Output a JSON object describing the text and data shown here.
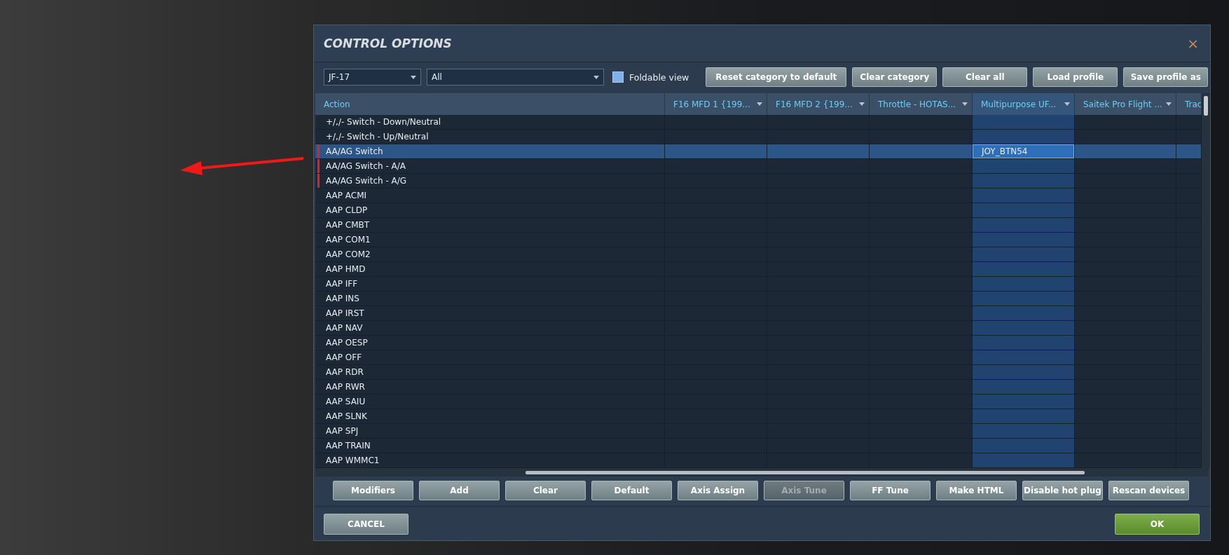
{
  "dialog": {
    "title": "CONTROL OPTIONS",
    "close": "×"
  },
  "toolbar": {
    "aircraft": "JF-17",
    "category": "All",
    "foldable": {
      "label": "Foldable view",
      "checked": false
    },
    "buttons": [
      {
        "label": "Reset category to default"
      },
      {
        "label": "Clear category"
      },
      {
        "label": "Clear all"
      },
      {
        "label": "Load profile"
      },
      {
        "label": "Save profile as"
      }
    ]
  },
  "table": {
    "columns": [
      {
        "label": "Action",
        "selected": false
      },
      {
        "label": "F16 MFD 1 {199...",
        "selected": false
      },
      {
        "label": "F16 MFD 2 {199...",
        "selected": false
      },
      {
        "label": "Throttle - HOTAS...",
        "selected": false
      },
      {
        "label": "Multipurpose UF...",
        "selected": true
      },
      {
        "label": "Saitek Pro Flight ...",
        "selected": false
      },
      {
        "label": "Trac",
        "selected": false
      }
    ],
    "rows": [
      {
        "action": "+/,/- Switch - Down/Neutral",
        "marked": false,
        "selected": false
      },
      {
        "action": "+/,/- Switch - Up/Neutral",
        "marked": false,
        "selected": false
      },
      {
        "action": "AA/AG Switch",
        "marked": true,
        "selected": true,
        "cells": [
          {},
          {},
          {},
          {
            "text": "JOY_BTN54",
            "selected": true
          }
        ]
      },
      {
        "action": "AA/AG Switch - A/A",
        "marked": true,
        "selected": false
      },
      {
        "action": "AA/AG Switch - A/G",
        "marked": true,
        "selected": false
      },
      {
        "action": "AAP ACMI",
        "marked": false,
        "selected": false
      },
      {
        "action": "AAP CLDP",
        "marked": false,
        "selected": false
      },
      {
        "action": "AAP CMBT",
        "marked": false,
        "selected": false
      },
      {
        "action": "AAP COM1",
        "marked": false,
        "selected": false
      },
      {
        "action": "AAP COM2",
        "marked": false,
        "selected": false
      },
      {
        "action": "AAP HMD",
        "marked": false,
        "selected": false
      },
      {
        "action": "AAP IFF",
        "marked": false,
        "selected": false
      },
      {
        "action": "AAP INS",
        "marked": false,
        "selected": false
      },
      {
        "action": "AAP IRST",
        "marked": false,
        "selected": false
      },
      {
        "action": "AAP NAV",
        "marked": false,
        "selected": false
      },
      {
        "action": "AAP OESP",
        "marked": false,
        "selected": false
      },
      {
        "action": "AAP OFF",
        "marked": false,
        "selected": false
      },
      {
        "action": "AAP RDR",
        "marked": false,
        "selected": false
      },
      {
        "action": "AAP RWR",
        "marked": false,
        "selected": false
      },
      {
        "action": "AAP SAIU",
        "marked": false,
        "selected": false
      },
      {
        "action": "AAP SLNK",
        "marked": false,
        "selected": false
      },
      {
        "action": "AAP SPJ",
        "marked": false,
        "selected": false
      },
      {
        "action": "AAP TRAIN",
        "marked": false,
        "selected": false
      },
      {
        "action": "AAP WMMC1",
        "marked": false,
        "selected": false
      }
    ]
  },
  "buttons": [
    {
      "label": "Modifiers",
      "disabled": false
    },
    {
      "label": "Add",
      "disabled": false
    },
    {
      "label": "Clear",
      "disabled": false
    },
    {
      "label": "Default",
      "disabled": false
    },
    {
      "label": "Axis Assign",
      "disabled": false
    },
    {
      "label": "Axis Tune",
      "disabled": true
    },
    {
      "label": "FF Tune",
      "disabled": false
    },
    {
      "label": "Make HTML",
      "disabled": false
    },
    {
      "label": "Disable hot plug",
      "disabled": false
    },
    {
      "label": "Rescan devices",
      "disabled": false
    }
  ],
  "footer": {
    "cancel": "CANCEL",
    "ok": "OK"
  }
}
